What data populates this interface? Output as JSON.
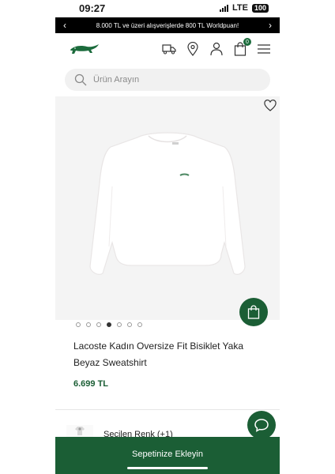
{
  "status_bar": {
    "time": "09:27",
    "network": "LTE",
    "battery": "100"
  },
  "promo": {
    "text": "8.000 TL ve üzeri alışverişlerde 800 TL Worldpuan!",
    "prev_icon": "chevron-left-icon",
    "next_icon": "chevron-right-icon"
  },
  "header": {
    "logo": "lacoste-crocodile-logo",
    "icons": [
      "truck-icon",
      "location-pin-icon",
      "user-icon",
      "cart-icon",
      "hamburger-menu-icon"
    ],
    "cart_count": "0"
  },
  "search": {
    "placeholder": "Ürün Arayın",
    "icon": "search-icon"
  },
  "product": {
    "title": "Lacoste Kadın Oversize Fit Bisiklet Yaka Beyaz Sweatshirt",
    "price": "6.699 TL",
    "image_count": 7,
    "active_image": 4,
    "wishlist_icon": "heart-icon"
  },
  "color": {
    "label": "Seçilen Renk (+1)"
  },
  "cta": {
    "add_to_cart": "Sepetinize Ekleyin"
  },
  "colors": {
    "brand_green": "#1b5e35",
    "promo_bg": "#000000"
  }
}
